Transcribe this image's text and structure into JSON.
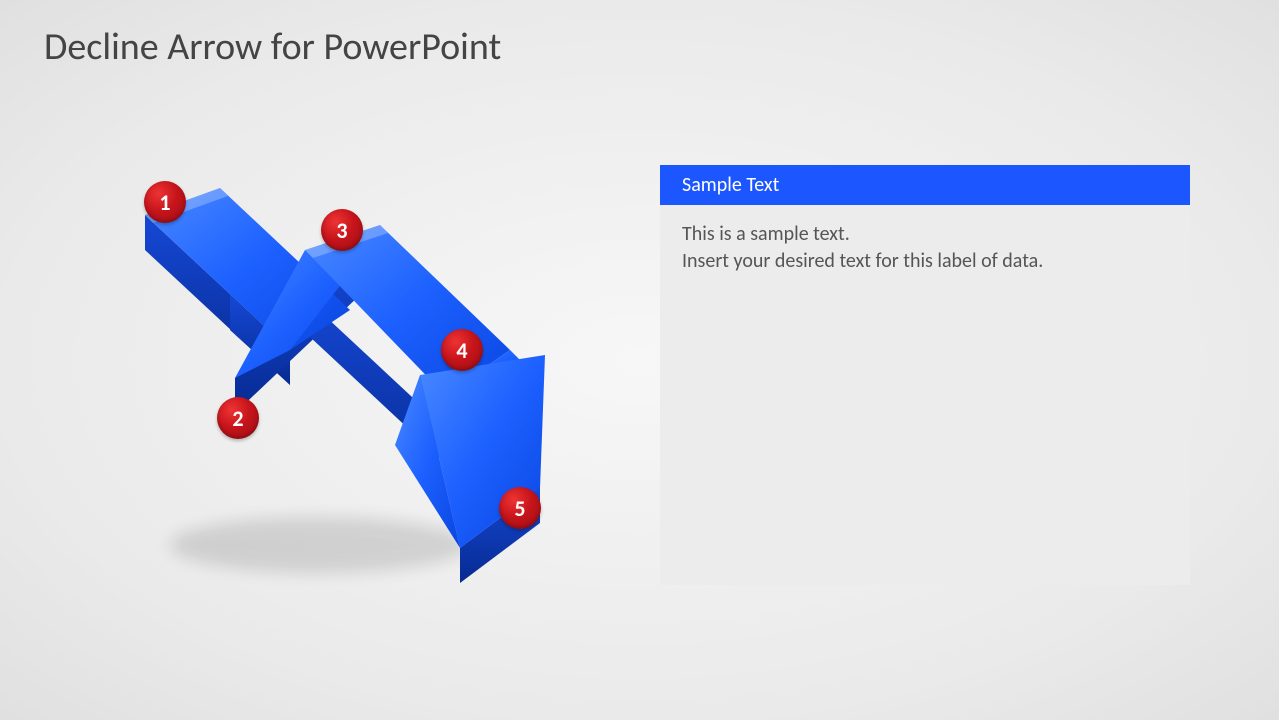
{
  "title": "Decline Arrow for PowerPoint",
  "markers": {
    "m1": "1",
    "m2": "2",
    "m3": "3",
    "m4": "4",
    "m5": "5"
  },
  "textbox": {
    "header": "Sample Text",
    "body": "This is a sample text.\nInsert your desired text for this label of data."
  },
  "colors": {
    "arrow_main": "#1c60ff",
    "arrow_side": "#0a3fc8",
    "marker": "#c6141b",
    "header_bg": "#1c56ff"
  }
}
